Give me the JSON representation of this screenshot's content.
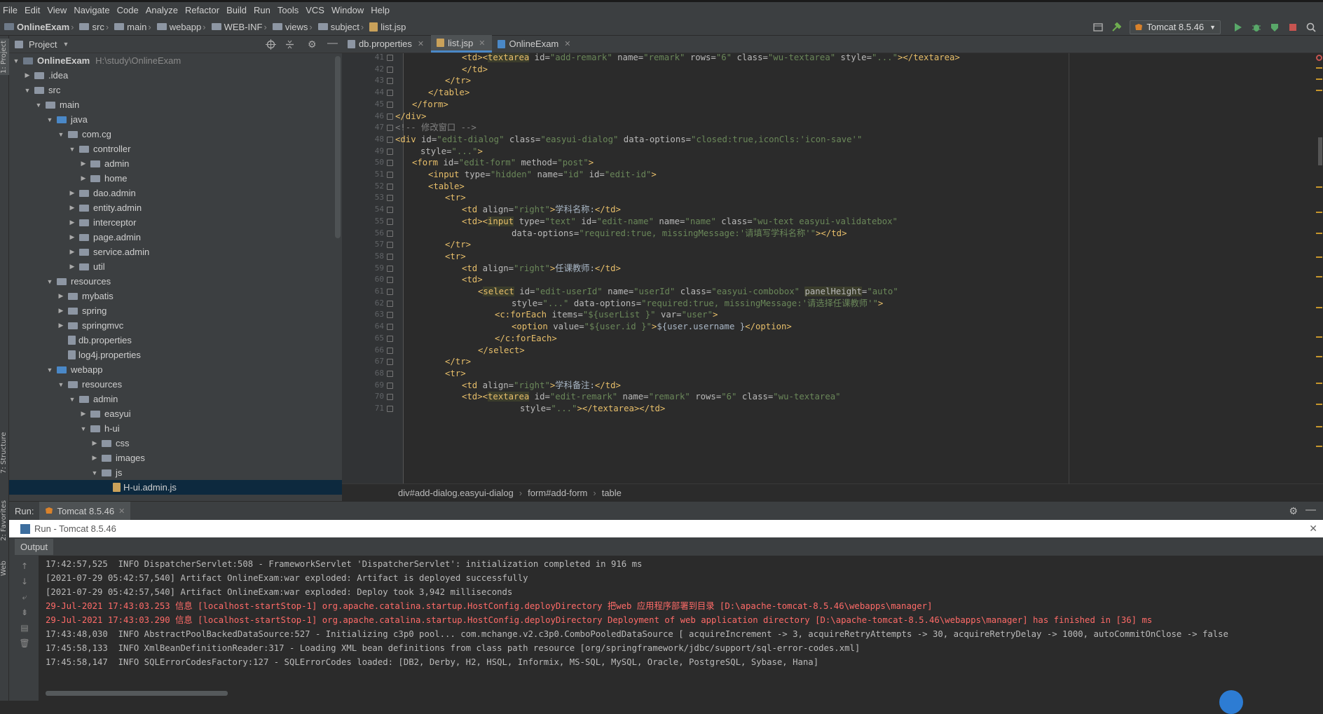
{
  "menu": [
    "File",
    "Edit",
    "View",
    "Navigate",
    "Code",
    "Analyze",
    "Refactor",
    "Build",
    "Run",
    "Tools",
    "VCS",
    "Window",
    "Help"
  ],
  "breadcrumb": [
    "OnlineExam",
    "src",
    "main",
    "webapp",
    "WEB-INF",
    "views",
    "subject",
    "list.jsp"
  ],
  "run_config": "Tomcat 8.5.46",
  "left_tabs": {
    "project": "1: Project",
    "structure": "7: Structure",
    "favorites": "2: Favorites",
    "web": "Web"
  },
  "project_panel": {
    "title": "Project",
    "tree": [
      {
        "label": "OnlineExam",
        "extra": "H:\\study\\OnlineExam",
        "depth": 0,
        "type": "module",
        "expanded": true
      },
      {
        "label": ".idea",
        "depth": 1,
        "type": "folder",
        "expanded": false
      },
      {
        "label": "src",
        "depth": 1,
        "type": "folder",
        "expanded": true
      },
      {
        "label": "main",
        "depth": 2,
        "type": "folder",
        "expanded": true
      },
      {
        "label": "java",
        "depth": 3,
        "type": "src-folder",
        "expanded": true
      },
      {
        "label": "com.cg",
        "depth": 4,
        "type": "package",
        "expanded": true
      },
      {
        "label": "controller",
        "depth": 5,
        "type": "package",
        "expanded": true
      },
      {
        "label": "admin",
        "depth": 6,
        "type": "package",
        "expanded": false
      },
      {
        "label": "home",
        "depth": 6,
        "type": "package",
        "expanded": false
      },
      {
        "label": "dao.admin",
        "depth": 5,
        "type": "package",
        "expanded": false
      },
      {
        "label": "entity.admin",
        "depth": 5,
        "type": "package",
        "expanded": false
      },
      {
        "label": "interceptor",
        "depth": 5,
        "type": "package",
        "expanded": false
      },
      {
        "label": "page.admin",
        "depth": 5,
        "type": "package",
        "expanded": false
      },
      {
        "label": "service.admin",
        "depth": 5,
        "type": "package",
        "expanded": false
      },
      {
        "label": "util",
        "depth": 5,
        "type": "package",
        "expanded": false
      },
      {
        "label": "resources",
        "depth": 3,
        "type": "res-folder",
        "expanded": true
      },
      {
        "label": "mybatis",
        "depth": 4,
        "type": "folder",
        "expanded": false
      },
      {
        "label": "spring",
        "depth": 4,
        "type": "folder",
        "expanded": false
      },
      {
        "label": "springmvc",
        "depth": 4,
        "type": "folder",
        "expanded": false
      },
      {
        "label": "db.properties",
        "depth": 4,
        "type": "file"
      },
      {
        "label": "log4j.properties",
        "depth": 4,
        "type": "file"
      },
      {
        "label": "webapp",
        "depth": 3,
        "type": "web-folder",
        "expanded": true
      },
      {
        "label": "resources",
        "depth": 4,
        "type": "folder",
        "expanded": true
      },
      {
        "label": "admin",
        "depth": 5,
        "type": "folder",
        "expanded": true
      },
      {
        "label": "easyui",
        "depth": 6,
        "type": "folder",
        "expanded": false
      },
      {
        "label": "h-ui",
        "depth": 6,
        "type": "folder",
        "expanded": true
      },
      {
        "label": "css",
        "depth": 7,
        "type": "folder",
        "expanded": false
      },
      {
        "label": "images",
        "depth": 7,
        "type": "folder",
        "expanded": false
      },
      {
        "label": "js",
        "depth": 7,
        "type": "folder",
        "expanded": true
      },
      {
        "label": "H-ui.admin.js",
        "depth": 8,
        "type": "jsfile",
        "selected": true
      }
    ]
  },
  "editor_tabs": [
    {
      "label": "db.properties",
      "active": false
    },
    {
      "label": "list.jsp",
      "active": true
    },
    {
      "label": "OnlineExam",
      "active": false
    }
  ],
  "code_lines": [
    {
      "n": "41",
      "indent": 8,
      "html": "<span class=t>&lt;td&gt;&lt;</span><span class=hl>textarea</span> <span class=a>id=</span><span class=s>\"add-remark\"</span> <span class=a>name=</span><span class=s>\"remark\"</span> <span class=a>rows=</span><span class=s>\"6\"</span> <span class=a>class=</span><span class=s>\"wu-textarea\"</span> <span class=a>style=</span><span class=s>\"...\"</span><span class=t>&gt;&lt;/textarea&gt;</span>"
    },
    {
      "n": "42",
      "indent": 8,
      "html": "<span class=t>&lt;/td&gt;</span>"
    },
    {
      "n": "43",
      "indent": 6,
      "html": "<span class=t>&lt;/tr&gt;</span>"
    },
    {
      "n": "44",
      "indent": 4,
      "html": "<span class=t>&lt;/table&gt;</span>"
    },
    {
      "n": "45",
      "indent": 2,
      "html": "<span class=t>&lt;/form&gt;</span>"
    },
    {
      "n": "46",
      "indent": 0,
      "html": "<span class=t>&lt;/div&gt;</span>"
    },
    {
      "n": "47",
      "indent": 0,
      "html": "<span class=cm>&lt;!-- 修改窗口 --&gt;</span>"
    },
    {
      "n": "48",
      "indent": 0,
      "html": "<span class=t>&lt;div</span> <span class=a>id=</span><span class=s>\"edit-dialog\"</span> <span class=a>class=</span><span class=s>\"easyui-dialog\"</span> <span class=a>data-options=</span><span class=s>\"closed:true,iconCls:'icon-save'\"</span>"
    },
    {
      "n": "49",
      "indent": 3,
      "html": "<span class=a>style=</span><span class=s>\"...\"</span><span class=t>&gt;</span>"
    },
    {
      "n": "50",
      "indent": 2,
      "html": "<span class=t>&lt;form</span> <span class=a>id=</span><span class=s>\"edit-form\"</span> <span class=a>method=</span><span class=s>\"post\"</span><span class=t>&gt;</span>"
    },
    {
      "n": "51",
      "indent": 4,
      "html": "<span class=t>&lt;input</span> <span class=a>type=</span><span class=s>\"hidden\"</span> <span class=a>name=</span><span class=s>\"id\"</span> <span class=a>id=</span><span class=s>\"edit-id\"</span><span class=t>&gt;</span>"
    },
    {
      "n": "52",
      "indent": 4,
      "html": "<span class=t>&lt;table&gt;</span>"
    },
    {
      "n": "53",
      "indent": 6,
      "html": "<span class=t>&lt;tr&gt;</span>"
    },
    {
      "n": "54",
      "indent": 8,
      "html": "<span class=t>&lt;td</span> <span class=a>align=</span><span class=s>\"right\"</span><span class=t>&gt;</span>学科名称:<span class=t>&lt;/td&gt;</span>"
    },
    {
      "n": "55",
      "indent": 8,
      "html": "<span class=t>&lt;td&gt;&lt;</span><span class=hl>input</span> <span class=a>type=</span><span class=s>\"text\"</span> <span class=a>id=</span><span class=s>\"edit-name\"</span> <span class=a>name=</span><span class=s>\"name\"</span> <span class=a>class=</span><span class=s>\"wu-text easyui-validatebox\"</span>"
    },
    {
      "n": "56",
      "indent": 14,
      "html": "<span class=a>data-options=</span><span class=s>\"required:true, missingMessage:'请填写学科名称'\"</span><span class=t>&gt;&lt;/td&gt;</span>"
    },
    {
      "n": "57",
      "indent": 6,
      "html": "<span class=t>&lt;/tr&gt;</span>"
    },
    {
      "n": "58",
      "indent": 6,
      "html": "<span class=t>&lt;tr&gt;</span>"
    },
    {
      "n": "59",
      "indent": 8,
      "html": "<span class=t>&lt;td</span> <span class=a>align=</span><span class=s>\"right\"</span><span class=t>&gt;</span>任课教师:<span class=t>&lt;/td&gt;</span>"
    },
    {
      "n": "60",
      "indent": 8,
      "html": "<span class=t>&lt;td&gt;</span>"
    },
    {
      "n": "61",
      "indent": 10,
      "html": "<span class=t>&lt;</span><span class=hl>select</span> <span class=a>id=</span><span class=s>\"edit-userId\"</span> <span class=a>name=</span><span class=s>\"userId\"</span> <span class=a>class=</span><span class=s>\"easyui-combobox\"</span> <span class=hl style=\"color:#bababa\">panelHeight</span><span class=a>=</span><span class=s>\"auto\"</span>"
    },
    {
      "n": "62",
      "indent": 14,
      "html": "<span class=a>style=</span><span class=s>\"...\"</span> <span class=a>data-options=</span><span class=s>\"required:true, missingMessage:'请选择任课教师'\"</span><span class=t>&gt;</span>"
    },
    {
      "n": "63",
      "indent": 12,
      "html": "<span class=t>&lt;c:forEach</span> <span class=a>items=</span><span class=s>\"${userList }\"</span> <span class=a>var=</span><span class=s>\"user\"</span><span class=t>&gt;</span>"
    },
    {
      "n": "64",
      "indent": 14,
      "html": "<span class=t>&lt;option</span> <span class=a>value=</span><span class=s>\"${user.id }\"</span><span class=t>&gt;</span>${user.username }<span class=t>&lt;/option&gt;</span>"
    },
    {
      "n": "65",
      "indent": 12,
      "html": "<span class=t>&lt;/c:forEach&gt;</span>"
    },
    {
      "n": "66",
      "indent": 10,
      "html": "<span class=t>&lt;/select&gt;</span>"
    },
    {
      "n": "67",
      "indent": 6,
      "html": "<span class=t>&lt;/tr&gt;</span>"
    },
    {
      "n": "68",
      "indent": 6,
      "html": "<span class=t>&lt;tr&gt;</span>"
    },
    {
      "n": "69",
      "indent": 8,
      "html": "<span class=t>&lt;td</span> <span class=a>align=</span><span class=s>\"right\"</span><span class=t>&gt;</span>学科备注:<span class=t>&lt;/td&gt;</span>"
    },
    {
      "n": "70",
      "indent": 8,
      "html": "<span class=t>&lt;td&gt;&lt;</span><span class=hl>textarea</span> <span class=a>id=</span><span class=s>\"edit-remark\"</span> <span class=a>name=</span><span class=s>\"remark\"</span> <span class=a>rows=</span><span class=s>\"6\"</span> <span class=a>class=</span><span class=s>\"wu-textarea\"</span>"
    },
    {
      "n": "71",
      "indent": 15,
      "html": "<span class=a>style=</span><span class=s>\"...\"</span><span class=t>&gt;&lt;/textarea&gt;&lt;/td&gt;</span>"
    }
  ],
  "editor_breadcrumb": [
    "div#add-dialog.easyui-dialog",
    "form#add-form",
    "table"
  ],
  "run_panel": {
    "label": "Run:",
    "tab": "Tomcat 8.5.46",
    "window_title": "Run - Tomcat 8.5.46",
    "output_tab": "Output"
  },
  "console_lines": [
    {
      "text": "17:42:57,525  INFO DispatcherServlet:508 - FrameworkServlet 'DispatcherServlet': initialization completed in 916 ms",
      "red": false
    },
    {
      "text": "[2021-07-29 05:42:57,540] Artifact OnlineExam:war exploded: Artifact is deployed successfully",
      "red": false
    },
    {
      "text": "[2021-07-29 05:42:57,540] Artifact OnlineExam:war exploded: Deploy took 3,942 milliseconds",
      "red": false
    },
    {
      "text": "29-Jul-2021 17:43:03.253 信息 [localhost-startStop-1] org.apache.catalina.startup.HostConfig.deployDirectory 把web 应用程序部署到目录 [D:\\apache-tomcat-8.5.46\\webapps\\manager]",
      "red": true
    },
    {
      "text": "29-Jul-2021 17:43:03.290 信息 [localhost-startStop-1] org.apache.catalina.startup.HostConfig.deployDirectory Deployment of web application directory [D:\\apache-tomcat-8.5.46\\webapps\\manager] has finished in [36] ms",
      "red": true
    },
    {
      "text": "17:43:48,030  INFO AbstractPoolBackedDataSource:527 - Initializing c3p0 pool... com.mchange.v2.c3p0.ComboPooledDataSource [ acquireIncrement -> 3, acquireRetryAttempts -> 30, acquireRetryDelay -> 1000, autoCommitOnClose -> false",
      "red": false
    },
    {
      "text": "17:45:58,133  INFO XmlBeanDefinitionReader:317 - Loading XML bean definitions from class path resource [org/springframework/jdbc/support/sql-error-codes.xml]",
      "red": false
    },
    {
      "text": "17:45:58,147  INFO SQLErrorCodesFactory:127 - SQLErrorCodes loaded: [DB2, Derby, H2, HSQL, Informix, MS-SQL, MySQL, Oracle, PostgreSQL, Sybase, Hana]",
      "red": false
    }
  ],
  "colors": {
    "accent": "#4a88c7",
    "selection": "#0d293e",
    "tag": "#e8bf6a",
    "string": "#6a8759",
    "error": "#ff6b68"
  },
  "icons": [
    "project-structure-icon",
    "build-hammer-icon",
    "run-icon",
    "debug-icon",
    "coverage-icon",
    "stop-icon",
    "search-icon",
    "locate-icon",
    "collapse-icon",
    "gear-icon",
    "minimize-icon"
  ]
}
